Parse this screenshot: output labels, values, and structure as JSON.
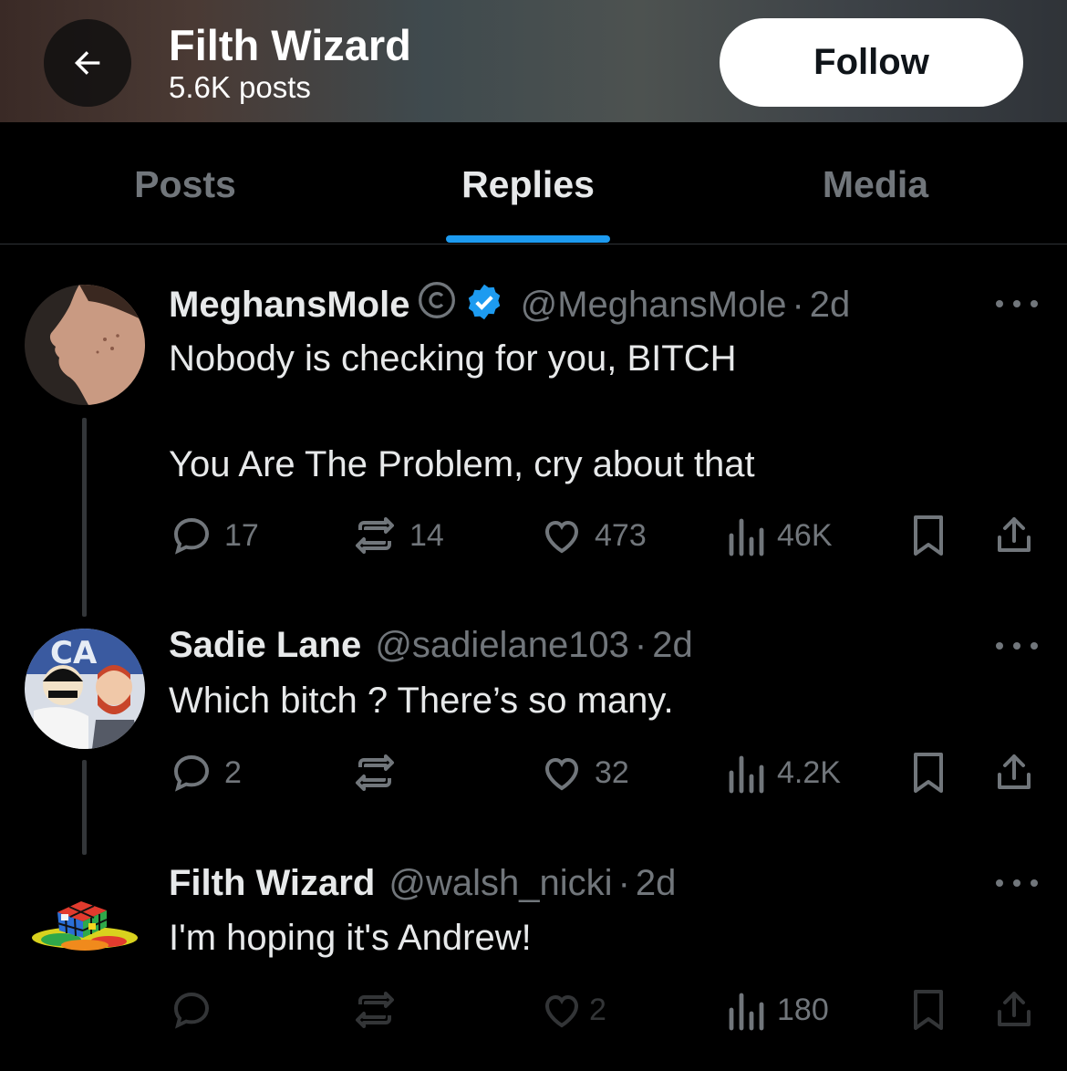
{
  "header": {
    "title": "Filth Wizard",
    "posts_count": "5.6K posts",
    "follow_label": "Follow",
    "back_icon": "arrow-left-icon"
  },
  "tabs": [
    {
      "label": "Posts",
      "active": false
    },
    {
      "label": "Replies",
      "active": true
    },
    {
      "label": "Media",
      "active": false
    }
  ],
  "accent_color": "#1d9bf0",
  "posts": [
    {
      "name": "MeghansMole",
      "handle": "@MeghansMole",
      "dot": "·",
      "time": "2d",
      "text_lines": [
        "Nobody is checking for you, BITCH",
        "You Are The Problem, cry about that"
      ],
      "replies": "17",
      "reposts": "14",
      "likes": "473",
      "views": "46K"
    },
    {
      "name": "Sadie Lane",
      "handle": "@sadielane103",
      "dot": "·",
      "time": "2d",
      "text_lines": [
        "Which bitch ? There’s so many."
      ],
      "replies": "2",
      "reposts": "",
      "likes": "32",
      "views": "4.2K"
    },
    {
      "name": "Filth Wizard",
      "handle": "@walsh_nicki",
      "dot": "·",
      "time": "2d",
      "text_lines": [
        "I'm hoping it's Andrew!"
      ],
      "replies": "",
      "reposts": "",
      "likes": "2",
      "views": "180"
    }
  ]
}
